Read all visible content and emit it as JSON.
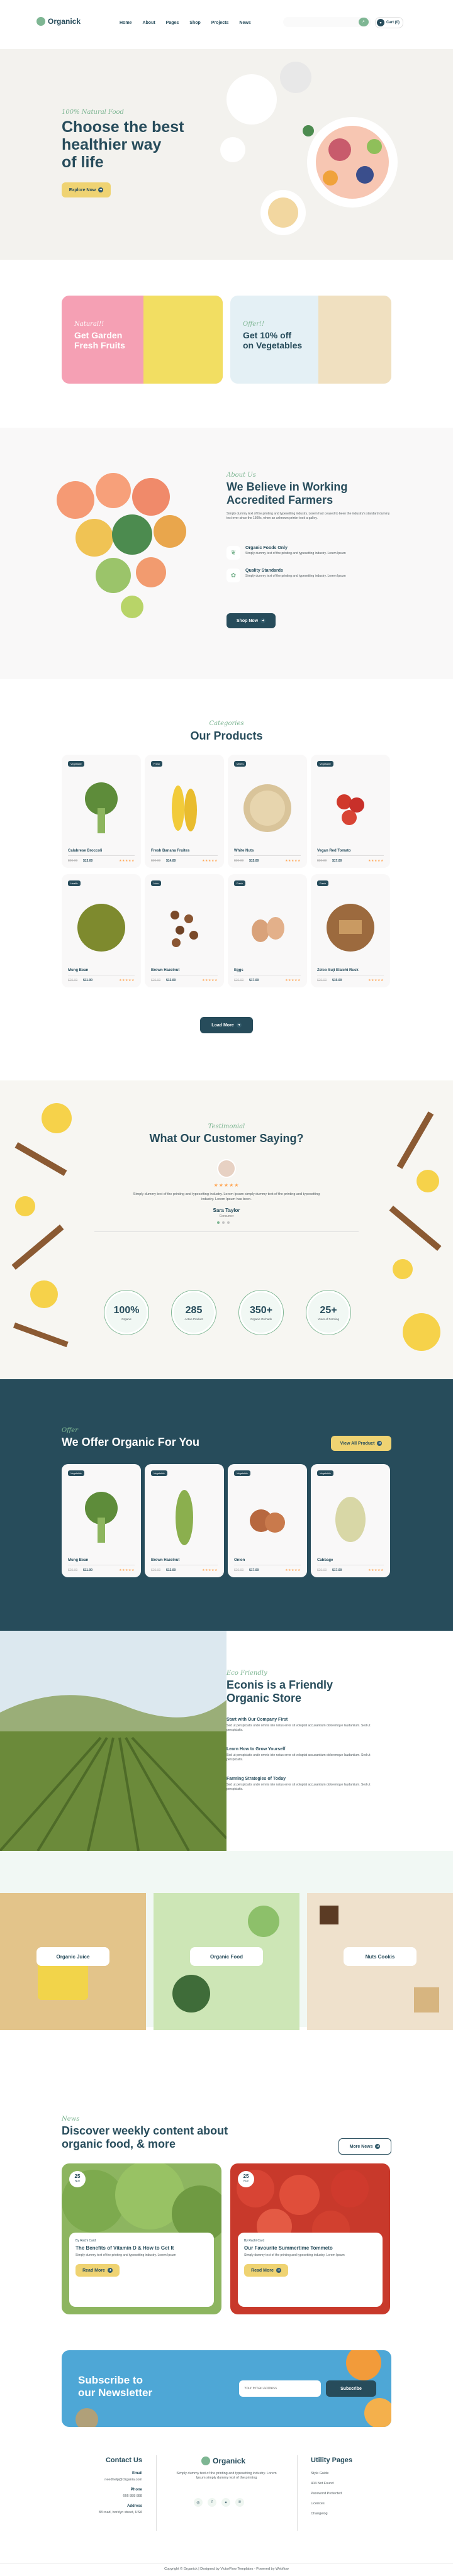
{
  "header": {
    "logo": "Organick",
    "nav": [
      "Home",
      "About",
      "Pages",
      "Shop",
      "Projects",
      "News"
    ],
    "search_placeholder": "",
    "cart_label": "Cart (0)"
  },
  "hero": {
    "tagline": "100% Natural Food",
    "title_line1": "Choose the best",
    "title_line2": "healthier way",
    "title_line3": "of life",
    "button": "Explore Now"
  },
  "offers": [
    {
      "script": "Natural!!",
      "title_line1": "Get Garden",
      "title_line2": "Fresh Fruits"
    },
    {
      "script": "Offer!!",
      "title_line1": "Get 10% off",
      "title_line2": "on Vegetables"
    }
  ],
  "about": {
    "script": "About Us",
    "title_line1": "We Believe in Working",
    "title_line2": "Accredited Farmers",
    "desc": "Simply dummy text of the printing and typesetting industry. Lorem had ceased to been the industry's standard dummy text ever since the 1500s, when an unknown printer took a galley.",
    "features": [
      {
        "title": "Organic Foods Only",
        "desc": "Simply dummy text of the printing and typesetting industry. Lorem Ipsum"
      },
      {
        "title": "Quality Standards",
        "desc": "Simply dummy text of the printing and typesetting industry. Lorem Ipsum"
      }
    ],
    "button": "Shop Now"
  },
  "products": {
    "script": "Categories",
    "title": "Our Products",
    "button": "Load More",
    "items": [
      {
        "tag": "Vegetable",
        "name": "Calabrese Broccoli",
        "old": "$20.00",
        "price": "$13.00",
        "stars": "★★★★★"
      },
      {
        "tag": "Fresh",
        "name": "Fresh Banana Fruites",
        "old": "$20.00",
        "price": "$14.00",
        "stars": "★★★★★"
      },
      {
        "tag": "Millets",
        "name": "White Nuts",
        "old": "$20.00",
        "price": "$15.00",
        "stars": "★★★★★"
      },
      {
        "tag": "Vegetable",
        "name": "Vegan Red Tomato",
        "old": "$20.00",
        "price": "$17.00",
        "stars": "★★★★★"
      },
      {
        "tag": "Health",
        "name": "Mung Bean",
        "old": "$20.00",
        "price": "$11.00",
        "stars": "★★★★★"
      },
      {
        "tag": "Nuts",
        "name": "Brown Hazelnut",
        "old": "$20.00",
        "price": "$12.00",
        "stars": "★★★★★"
      },
      {
        "tag": "Fresh",
        "name": "Eggs",
        "old": "$20.00",
        "price": "$17.00",
        "stars": "★★★★★"
      },
      {
        "tag": "Fresh",
        "name": "Zelco Suji Elaichi Rusk",
        "old": "$20.00",
        "price": "$15.00",
        "stars": "★★★★★"
      }
    ]
  },
  "testimonial": {
    "script": "Testimonial",
    "title": "What Our Customer Saying?",
    "stars": "★★★★★",
    "quote": "Simply dummy text of the printing and typesetting industry. Lorem Ipsum simply dummy text of the printing and typesetting industry. Lorem Ipsum has been.",
    "name": "Sara Taylor",
    "role": "Consumer",
    "stats": [
      {
        "n": "100%",
        "l": "Organic"
      },
      {
        "n": "285",
        "l": "Active Product"
      },
      {
        "n": "350+",
        "l": "Organic Orchads"
      },
      {
        "n": "25+",
        "l": "Years of Farming"
      }
    ]
  },
  "offer_section": {
    "script": "Offer",
    "title": "We Offer Organic For You",
    "button": "View All Product",
    "items": [
      {
        "tag": "Vegetable",
        "name": "Mung Bean",
        "old": "$20.00",
        "price": "$11.00",
        "stars": "★★★★★"
      },
      {
        "tag": "Vegetable",
        "name": "Brown Hazelnut",
        "old": "$20.00",
        "price": "$12.00",
        "stars": "★★★★★"
      },
      {
        "tag": "Vegetable",
        "name": "Onion",
        "old": "$20.00",
        "price": "$17.00",
        "stars": "★★★★★"
      },
      {
        "tag": "Vegetable",
        "name": "Cabbage",
        "old": "$20.00",
        "price": "$17.00",
        "stars": "★★★★★"
      }
    ]
  },
  "eco": {
    "script": "Eco Friendly",
    "title_line1": "Econis is a Friendly",
    "title_line2": "Organic Store",
    "items": [
      {
        "title": "Start with Our Company First",
        "desc": "Sed ut perspiciatis unde omnis iste natus error sit voluptat accusantium doloremque laudantium. Sed ut perspiciatis."
      },
      {
        "title": "Learn How to Grow Yourself",
        "desc": "Sed ut perspiciatis unde omnis iste natus error sit voluptat accusantium doloremque laudantium. Sed ut perspiciatis."
      },
      {
        "title": "Farming Strategies of Today",
        "desc": "Sed ut perspiciatis unde omnis iste natus error sit voluptat accusantium doloremque laudantium. Sed ut perspiciatis."
      }
    ]
  },
  "categories": [
    "Organic Juice",
    "Organic Food",
    "Nuts Cookis"
  ],
  "news": {
    "script": "News",
    "title_line1": "Discover weekly content about",
    "title_line2": "organic food, & more",
    "button": "More News",
    "posts": [
      {
        "day": "25",
        "month": "Nov",
        "author": "By Rachi Card",
        "title": "The Benefits of Vitamin D & How to Get It",
        "desc": "Simply dummy text of the printing and typesetting industry. Lorem Ipsum",
        "button": "Read More"
      },
      {
        "day": "25",
        "month": "Nov",
        "author": "By Rachi Card",
        "title": "Our Favourite Summertime Tommeto",
        "desc": "Simply dummy text of the printing and typesetting industry. Lorem Ipsum",
        "button": "Read More"
      }
    ]
  },
  "newsletter": {
    "title_line1": "Subscribe to",
    "title_line2": "our Newsletter",
    "placeholder": "Your Email Address",
    "button": "Subscribe"
  },
  "footer": {
    "contact_title": "Contact Us",
    "email_label": "Email",
    "email": "needhelp@Organia.com",
    "phone_label": "Phone",
    "phone": "666 888 888",
    "address_label": "Address",
    "address": "88 road, borklyn street, USA",
    "logo": "Organick",
    "about": "Simply dummy text of the printing and typesetting industry. Lorem Ipsum simply dummy text of the printing",
    "utility_title": "Utility Pages",
    "utility": [
      "Style Guide",
      "404 Not Found",
      "Password Protected",
      "Licences",
      "Changelog"
    ],
    "copyright": "Copyright © Organick | Designed by VictorFlow Templates - Powered by Webflow"
  },
  "colors": {
    "primary": "#274C5B",
    "accent": "#7EB693",
    "yellow": "#EFD372",
    "star": "#FFA858"
  }
}
